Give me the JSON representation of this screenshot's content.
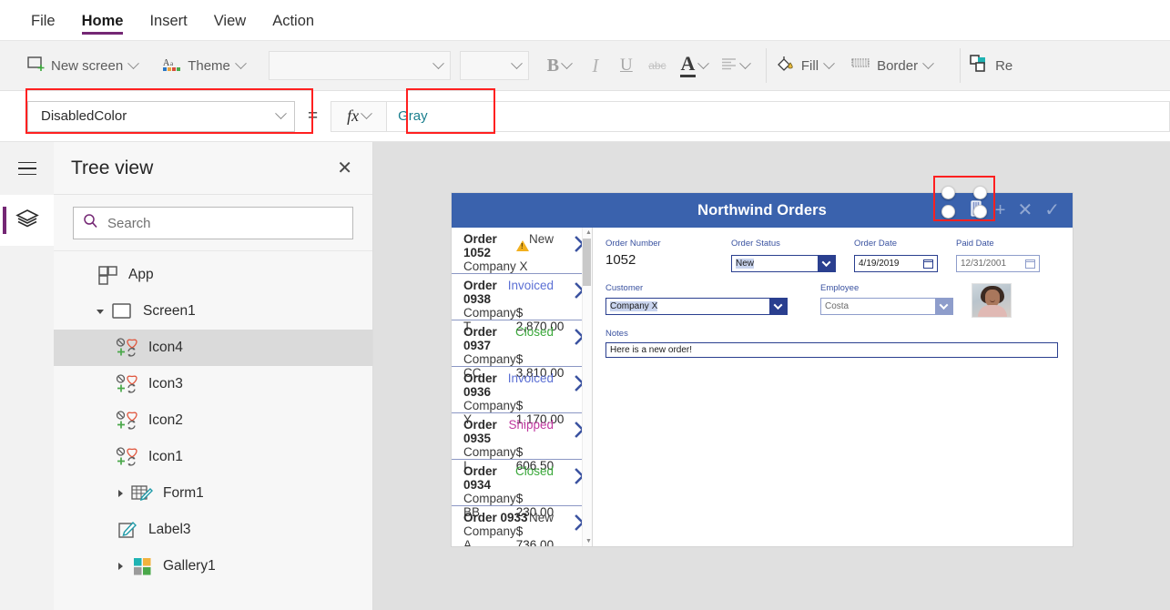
{
  "menu": {
    "tabs": [
      {
        "label": "File",
        "active": false
      },
      {
        "label": "Home",
        "active": true
      },
      {
        "label": "Insert",
        "active": false
      },
      {
        "label": "View",
        "active": false
      },
      {
        "label": "Action",
        "active": false
      }
    ]
  },
  "ribbon": {
    "new_screen": "New screen",
    "theme": "Theme",
    "font_value": "",
    "font_size_value": "",
    "bold": "B",
    "italic": "I",
    "underline": "U",
    "strikethrough": "abc",
    "font_color": "A",
    "align": "align-left",
    "fill": "Fill",
    "border": "Border",
    "reorder": "Re"
  },
  "property_bar": {
    "property": "DisabledColor",
    "equals": "=",
    "fx": "fx",
    "formula": "Gray",
    "formula_color": "#1a7f8e"
  },
  "tree": {
    "title": "Tree view",
    "close": "✕",
    "search_placeholder": "Search",
    "search_value": "",
    "items": [
      {
        "label": "App",
        "icon": "app-icon",
        "depth": 0,
        "twisty": "none",
        "selected": false
      },
      {
        "label": "Screen1",
        "icon": "screen-icon",
        "depth": 0,
        "twisty": "expanded",
        "selected": false
      },
      {
        "label": "Icon4",
        "icon": "icon-control",
        "depth": 1,
        "twisty": "none",
        "selected": true
      },
      {
        "label": "Icon3",
        "icon": "icon-control",
        "depth": 1,
        "twisty": "none",
        "selected": false
      },
      {
        "label": "Icon2",
        "icon": "icon-control",
        "depth": 1,
        "twisty": "none",
        "selected": false
      },
      {
        "label": "Icon1",
        "icon": "icon-control",
        "depth": 1,
        "twisty": "none",
        "selected": false
      },
      {
        "label": "Form1",
        "icon": "form-icon",
        "depth": 1,
        "twisty": "collapsed",
        "selected": false
      },
      {
        "label": "Label3",
        "icon": "label-icon",
        "depth": 1,
        "twisty": "none",
        "selected": false
      },
      {
        "label": "Gallery1",
        "icon": "gallery-icon",
        "depth": 1,
        "twisty": "collapsed",
        "selected": false
      }
    ]
  },
  "app": {
    "title": "Northwind Orders",
    "header_color": "#3a62ad",
    "header_icons": [
      "selected-icon",
      "plus-icon",
      "cancel-icon",
      "check-icon"
    ],
    "gallery": [
      {
        "order": "Order 1052",
        "company": "Company X",
        "status": "New",
        "amount": "",
        "warning": true
      },
      {
        "order": "Order 0938",
        "company": "Company T",
        "status": "Invoiced",
        "amount": "$ 2,870.00",
        "warning": false
      },
      {
        "order": "Order 0937",
        "company": "Company CC",
        "status": "Closed",
        "amount": "$ 3,810.00",
        "warning": false
      },
      {
        "order": "Order 0936",
        "company": "Company Y",
        "status": "Invoiced",
        "amount": "$ 1,170.00",
        "warning": false
      },
      {
        "order": "Order 0935",
        "company": "Company I",
        "status": "Shipped",
        "amount": "$ 606.50",
        "warning": false
      },
      {
        "order": "Order 0934",
        "company": "Company BB",
        "status": "Closed",
        "amount": "$ 230.00",
        "warning": false
      },
      {
        "order": "Order 0933",
        "company": "Company A",
        "status": "New",
        "amount": "$ 736.00",
        "warning": false
      }
    ],
    "form": {
      "order_number_label": "Order Number",
      "order_number_value": "1052",
      "order_status_label": "Order Status",
      "order_status_value": "New",
      "order_date_label": "Order Date",
      "order_date_value": "4/19/2019",
      "paid_date_label": "Paid Date",
      "paid_date_value": "12/31/2001",
      "customer_label": "Customer",
      "customer_value": "Company X",
      "employee_label": "Employee",
      "employee_value": "Costa",
      "notes_label": "Notes",
      "notes_value": "Here is a new order!"
    }
  },
  "annotations": {
    "accent": "#ff2020"
  }
}
